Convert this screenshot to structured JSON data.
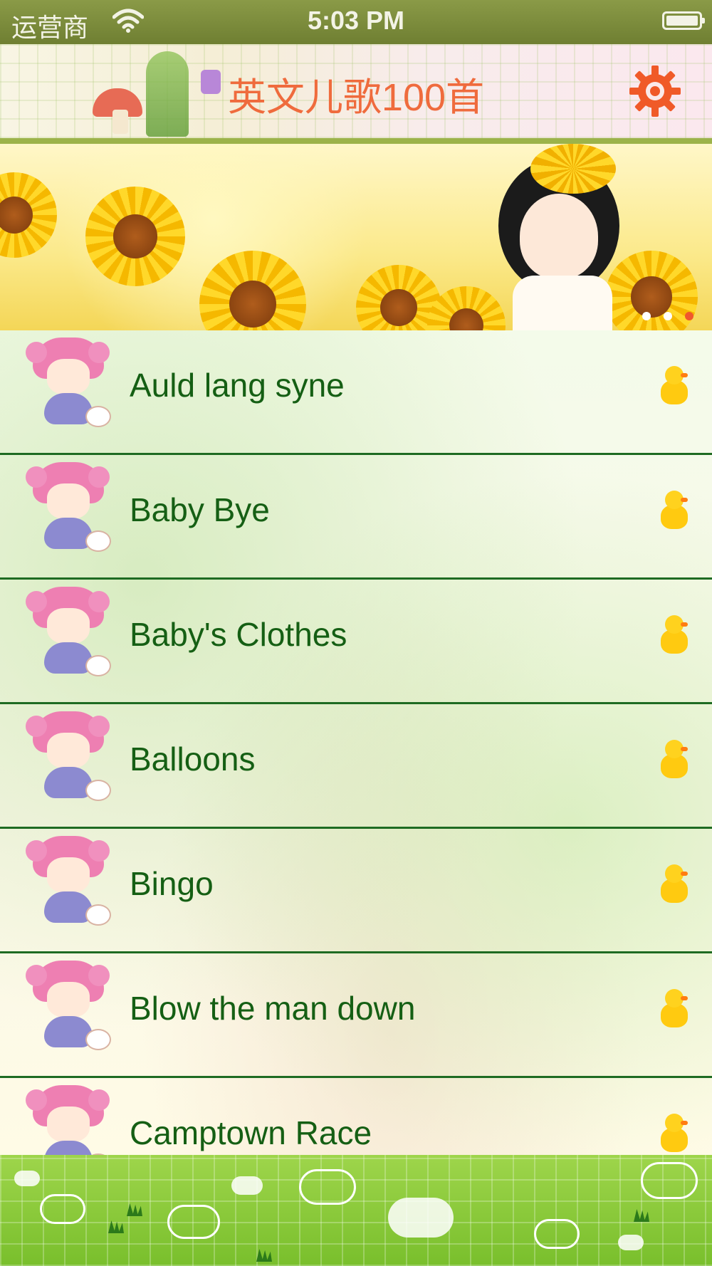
{
  "status_bar": {
    "carrier": "运营商",
    "time": "5:03 PM",
    "wifi_icon": "wifi-icon",
    "battery_icon": "battery-icon"
  },
  "nav": {
    "title": "英文儿歌100首",
    "settings_icon": "gear-icon",
    "accent_color": "#ef6b3d"
  },
  "banner": {
    "page_count": 3,
    "active_page": 3
  },
  "songs": [
    {
      "title": "Auld lang syne"
    },
    {
      "title": "Baby Bye"
    },
    {
      "title": "Baby's Clothes"
    },
    {
      "title": "Balloons"
    },
    {
      "title": "Bingo"
    },
    {
      "title": "Blow the man down"
    },
    {
      "title": "Camptown Race"
    }
  ],
  "colors": {
    "song_text": "#155f14",
    "divider": "#1e6b22",
    "status_bar": "#7c8c3c",
    "bottom_bar": "#8ccb3c"
  }
}
